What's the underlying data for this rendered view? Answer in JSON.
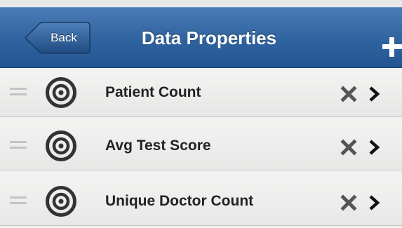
{
  "header": {
    "back_label": "Back",
    "title": "Data Properties",
    "add_icon": "plus-icon"
  },
  "colors": {
    "header_top": "#4a7bb5",
    "header_bottom": "#245592",
    "row_bg": "#eeeeed",
    "text": "#222222",
    "icon": "#333333"
  },
  "list": {
    "items": [
      {
        "label": "Patient Count",
        "icon": "target-icon"
      },
      {
        "label": "Avg Test Score",
        "icon": "target-icon"
      },
      {
        "label": "Unique Doctor Count",
        "icon": "target-icon"
      }
    ]
  }
}
